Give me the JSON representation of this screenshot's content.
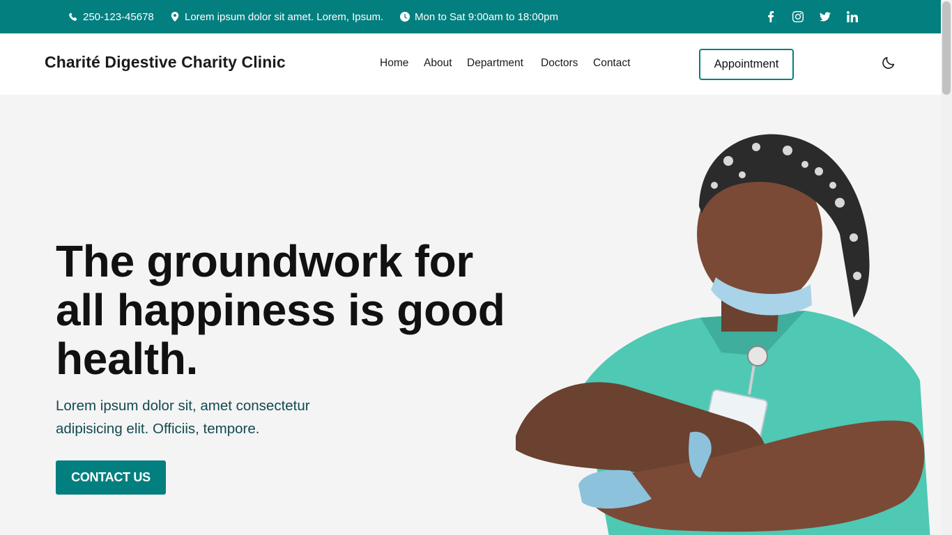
{
  "topbar": {
    "phone": "250-123-45678",
    "address": "Lorem ipsum dolor sit amet. Lorem, Ipsum.",
    "hours": "Mon to Sat 9:00am to 18:00pm",
    "social": [
      "facebook-icon",
      "instagram-icon",
      "twitter-icon",
      "linkedin-icon"
    ]
  },
  "header": {
    "brand": "Charité Digestive Charity Clinic",
    "nav": [
      "Home",
      "About",
      "Department",
      "Doctors",
      "Contact"
    ],
    "appointment": "Appointment",
    "theme_toggle": "moon-icon"
  },
  "hero": {
    "headline": "The groundwork for all happiness is good health.",
    "subtext": "Lorem ipsum dolor sit, amet consectetur adipisicing elit. Officiis, tempore.",
    "cta": "CONTACT US"
  },
  "colors": {
    "brand": "#047f80",
    "scrub": "#4fc8b4",
    "background": "#f4f4f4"
  }
}
